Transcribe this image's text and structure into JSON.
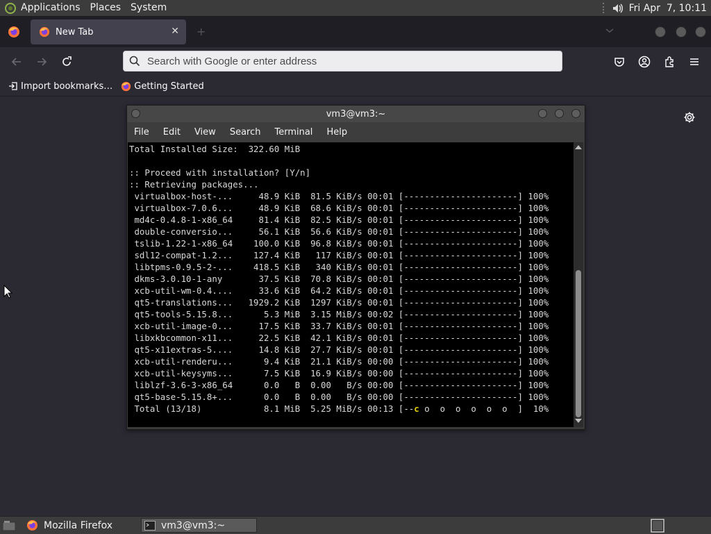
{
  "top_panel": {
    "menus": [
      "Applications",
      "Places",
      "System"
    ],
    "clock": "Fri Apr  7, 10:11",
    "icons": [
      "gnome-foot-icon",
      "volume-icon"
    ]
  },
  "browser": {
    "tab_title": "New Tab",
    "search_placeholder": "Search with Google or enter address",
    "bookmarks": [
      "Import bookmarks…",
      "Getting Started"
    ],
    "accent_color": "#ff9500",
    "icons": [
      "back-arrow-icon",
      "forward-arrow-icon",
      "reload-icon",
      "search-icon",
      "pocket-icon",
      "account-icon",
      "extensions-icon",
      "menu-icon",
      "settings-gear-icon"
    ]
  },
  "terminal": {
    "title": "vm3@vm3:~",
    "menus": [
      "File",
      "Edit",
      "View",
      "Search",
      "Terminal",
      "Help"
    ],
    "lines": [
      "Total Installed Size:  322.60 MiB",
      "",
      ":: Proceed with installation? [Y/n]",
      ":: Retrieving packages...",
      " virtualbox-host-...     48.9 KiB  81.5 KiB/s 00:01 [----------------------] 100%",
      " virtualbox-7.0.6...     48.9 KiB  68.6 KiB/s 00:01 [----------------------] 100%",
      " md4c-0.4.8-1-x86_64     81.4 KiB  82.5 KiB/s 00:01 [----------------------] 100%",
      " double-conversio...     56.1 KiB  56.6 KiB/s 00:01 [----------------------] 100%",
      " tslib-1.22-1-x86_64    100.0 KiB  96.8 KiB/s 00:01 [----------------------] 100%",
      " sdl12-compat-1.2...    127.4 KiB   117 KiB/s 00:01 [----------------------] 100%",
      " libtpms-0.9.5-2-...    418.5 KiB   340 KiB/s 00:01 [----------------------] 100%",
      " dkms-3.0.10-1-any       37.5 KiB  70.8 KiB/s 00:01 [----------------------] 100%",
      " xcb-util-wm-0.4....     33.6 KiB  64.2 KiB/s 00:01 [----------------------] 100%",
      " qt5-translations...   1929.2 KiB  1297 KiB/s 00:01 [----------------------] 100%",
      " qt5-tools-5.15.8...      5.3 MiB  3.15 MiB/s 00:02 [----------------------] 100%",
      " xcb-util-image-0...     17.5 KiB  33.7 KiB/s 00:01 [----------------------] 100%",
      " libxkbcommon-x11...     22.5 KiB  42.1 KiB/s 00:01 [----------------------] 100%",
      " qt5-x11extras-5....     14.8 KiB  27.7 KiB/s 00:01 [----------------------] 100%",
      " xcb-util-renderu...      9.4 KiB  21.1 KiB/s 00:00 [----------------------] 100%",
      " xcb-util-keysyms...      7.5 KiB  16.9 KiB/s 00:00 [----------------------] 100%",
      " liblzf-3.6-3-x86_64      0.0   B  0.00   B/s 00:00 [----------------------] 100%",
      " qt5-base-5.15.8+...      0.0   B  0.00   B/s 00:00 [----------------------] 100%",
      " Total (13/18)            8.1 MiB  5.25 MiB/s 00:13 [--c o  o  o  o  o  o  ]  10%"
    ],
    "pacman_color": "#e6d000"
  },
  "taskbar": {
    "items": [
      "Mozilla Firefox",
      "vm3@vm3:~"
    ],
    "icons": [
      "show-desktop-icon",
      "firefox-icon",
      "terminal-icon",
      "workspace-switcher-icon"
    ]
  }
}
